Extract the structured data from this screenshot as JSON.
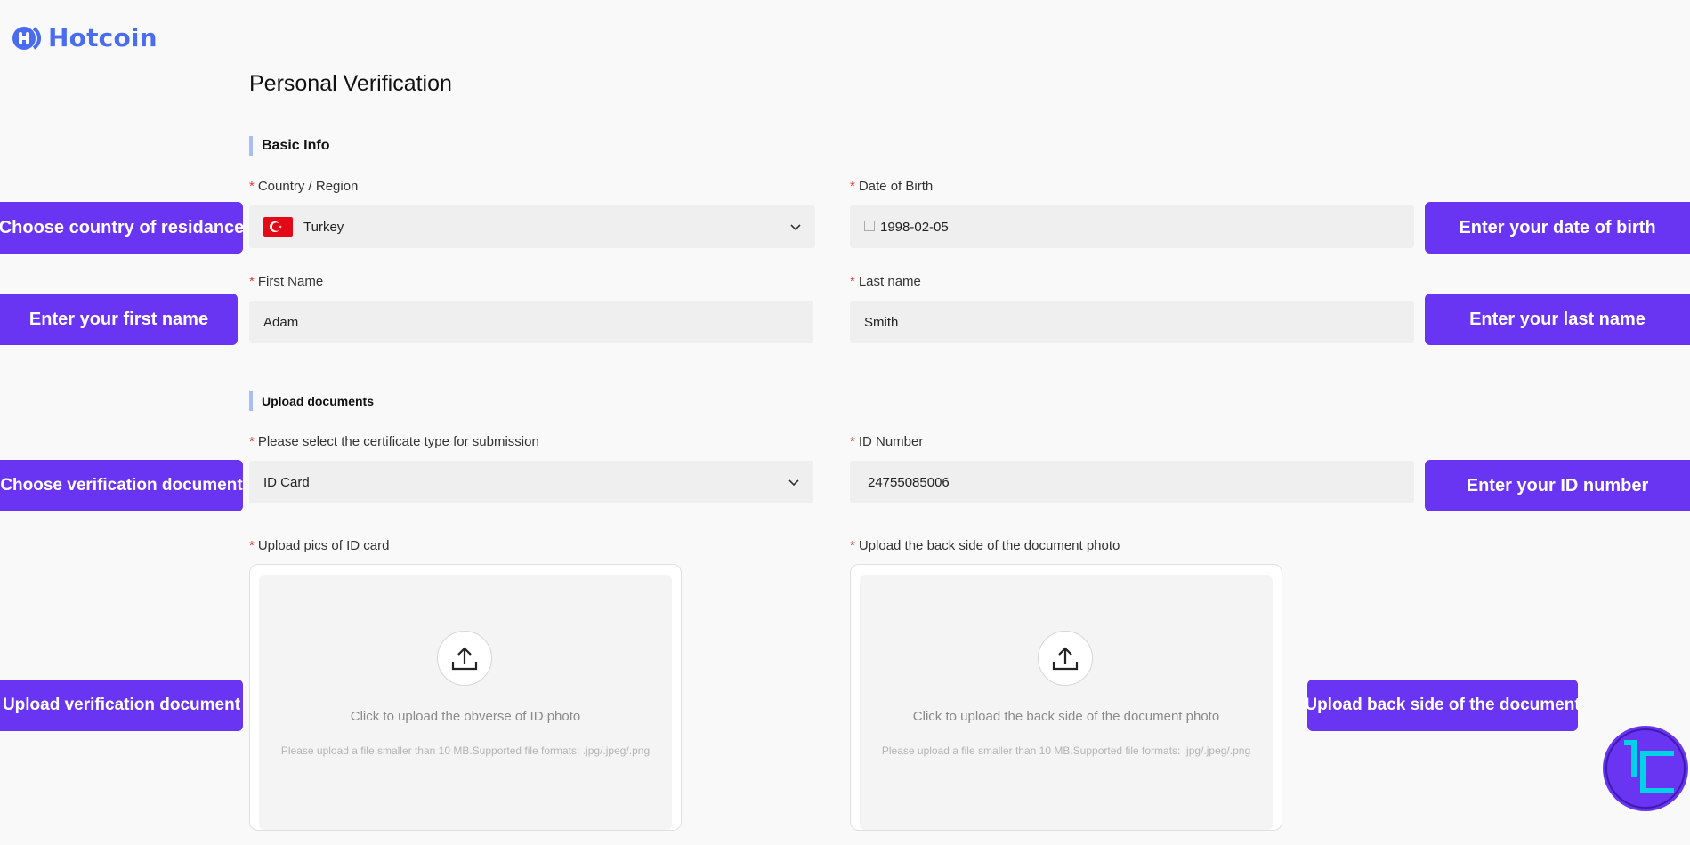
{
  "brand": {
    "name": "Hotcoin",
    "color": "#4a6cf0"
  },
  "page": {
    "title": "Personal Verification"
  },
  "sections": {
    "basic_info": "Basic Info",
    "upload_documents": "Upload documents"
  },
  "form": {
    "country": {
      "label": "Country / Region",
      "value": "Turkey",
      "flag": "turkey-flag"
    },
    "dob": {
      "label": "Date of Birth",
      "value": "1998-02-05"
    },
    "first_name": {
      "label": "First Name",
      "value": "Adam"
    },
    "last_name": {
      "label": "Last name",
      "value": "Smith"
    },
    "cert_type": {
      "label": "Please select the certificate type for submission",
      "value": "ID Card"
    },
    "id_number": {
      "label": "ID Number",
      "value": "24755085006"
    },
    "upload_front": {
      "label": "Upload pics of ID card",
      "prompt": "Click to upload the obverse of ID photo",
      "hint": "Please upload a file smaller than 10 MB.Supported file formats: .jpg/.jpeg/.png"
    },
    "upload_back": {
      "label": "Upload the back side of the document photo",
      "prompt": "Click to upload the back side of the document photo",
      "hint": "Please upload a file smaller than 10 MB.Supported file formats: .jpg/.jpeg/.png"
    }
  },
  "callouts": {
    "country": "Choose country of residance",
    "dob": "Enter your date of birth",
    "first_name": "Enter your first name",
    "last_name": "Enter your last name",
    "document": "Choose verification document",
    "id_number": "Enter your ID number",
    "upload_front": "Upload verification document",
    "upload_back": "Upload back side of the document"
  },
  "colors": {
    "accent": "#6a35f2",
    "required": "#e03a3a",
    "section_bar": "#a9bdf5"
  }
}
